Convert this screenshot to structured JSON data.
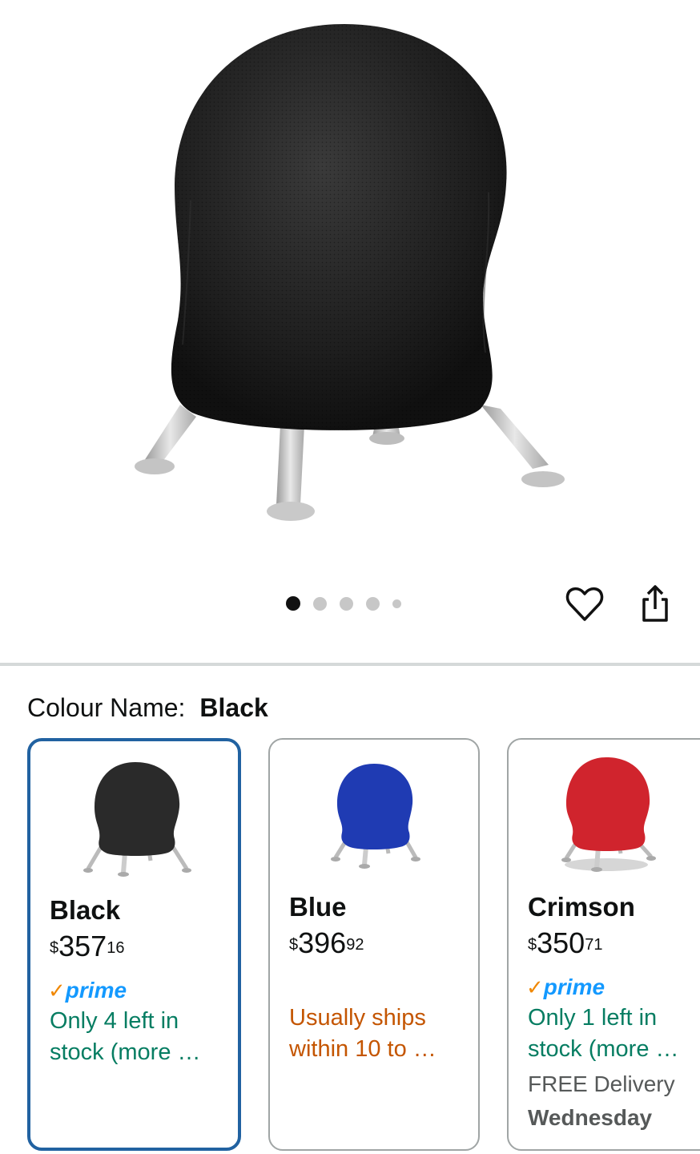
{
  "product": {
    "image_alt": "Black mesh ball chair with silver legs",
    "carousel": {
      "total_pages": 5,
      "current_page": 1
    },
    "actions": {
      "favourite_icon": "heart-icon",
      "share_icon": "share-icon"
    }
  },
  "colour_selector": {
    "label": "Colour Name:",
    "selected_value": "Black"
  },
  "variants": [
    {
      "name": "Black",
      "price_currency": "$",
      "price_whole": "357",
      "price_fraction": "16",
      "prime_check": "✓",
      "prime_word": "prime",
      "stock_line1": "Only 4 left in",
      "stock_line2": "stock (more …",
      "color": "#2a2a2a",
      "selected": true
    },
    {
      "name": "Blue",
      "price_currency": "$",
      "price_whole": "396",
      "price_fraction": "92",
      "ship_line1": "Usually ships",
      "ship_line2": "within 10 to …",
      "color": "#1f3bb3",
      "selected": false
    },
    {
      "name": "Crimson",
      "price_currency": "$",
      "price_whole": "350",
      "price_fraction": "71",
      "prime_check": "✓",
      "prime_word": "prime",
      "stock_line1": "Only 1 left in",
      "stock_line2": "stock (more …",
      "delivery_label": "FREE Delivery",
      "delivery_day": "Wednesday",
      "color": "#d0242d",
      "selected": false
    }
  ],
  "colors": {
    "selected_border": "#2162a1",
    "in_stock": "#067d62",
    "ship_warning": "#c45500",
    "prime_blue": "#1399ff",
    "prime_check": "#f08804"
  }
}
